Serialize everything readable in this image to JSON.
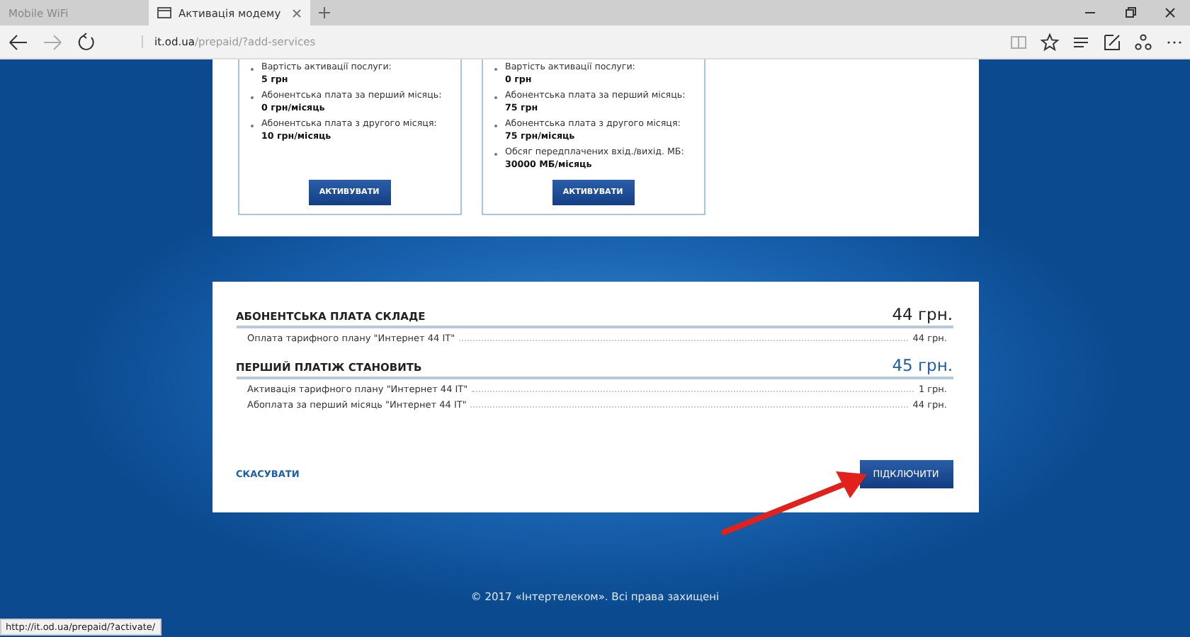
{
  "browser": {
    "tabs": [
      {
        "title": "Mobile WiFi",
        "selected": false
      },
      {
        "title": "Активація модему",
        "selected": true
      }
    ],
    "address": {
      "host": "it.od.ua",
      "path": "/prepaid/?add-services"
    },
    "status_url": "http://it.od.ua/prepaid/?activate/"
  },
  "plans": [
    {
      "items": [
        {
          "label": "Вартість активації послуги:",
          "value": "5 грн"
        },
        {
          "label": "Абонентська плата за перший місяць:",
          "value": "0 грн/місяць"
        },
        {
          "label": "Абонентська плата з другого місяця:",
          "value": "10 грн/місяць"
        }
      ],
      "button": "АКТИВУВАТИ"
    },
    {
      "items": [
        {
          "label": "Вартість активації послуги:",
          "value": "0 грн"
        },
        {
          "label": "Абонентська плата за перший місяць:",
          "value": "75 грн"
        },
        {
          "label": "Абонентська плата з другого місяця:",
          "value": "75 грн/місяць"
        },
        {
          "label": "Обсяг передплачених вхід./вихід. МБ:",
          "value": "30000 МБ/місяць"
        }
      ],
      "button": "АКТИВУВАТИ"
    }
  ],
  "summary": [
    {
      "title": "АБОНЕНТСЬКА ПЛАТА СКЛАДЕ",
      "total": "44 грн.",
      "emphasized": false,
      "lines": [
        {
          "label": "Оплата тарифного плану \"Интернет 44 IT\"",
          "amount": "44 грн."
        }
      ]
    },
    {
      "title": "ПЕРШИЙ ПЛАТІЖ СТАНОВИТЬ",
      "total": "45 грн.",
      "emphasized": true,
      "lines": [
        {
          "label": "Активація тарифного плану \"Интернет 44 IT\"",
          "amount": "1 грн."
        },
        {
          "label": "Абоплата за перший місяць \"Интернет 44 IT\"",
          "amount": "44 грн."
        }
      ]
    }
  ],
  "cancel_link": "СКАСУВАТИ",
  "connect_button": "ПІДКЛЮЧИТИ",
  "footer": "© 2017 «Інтертелеком». Всі права захищені"
}
